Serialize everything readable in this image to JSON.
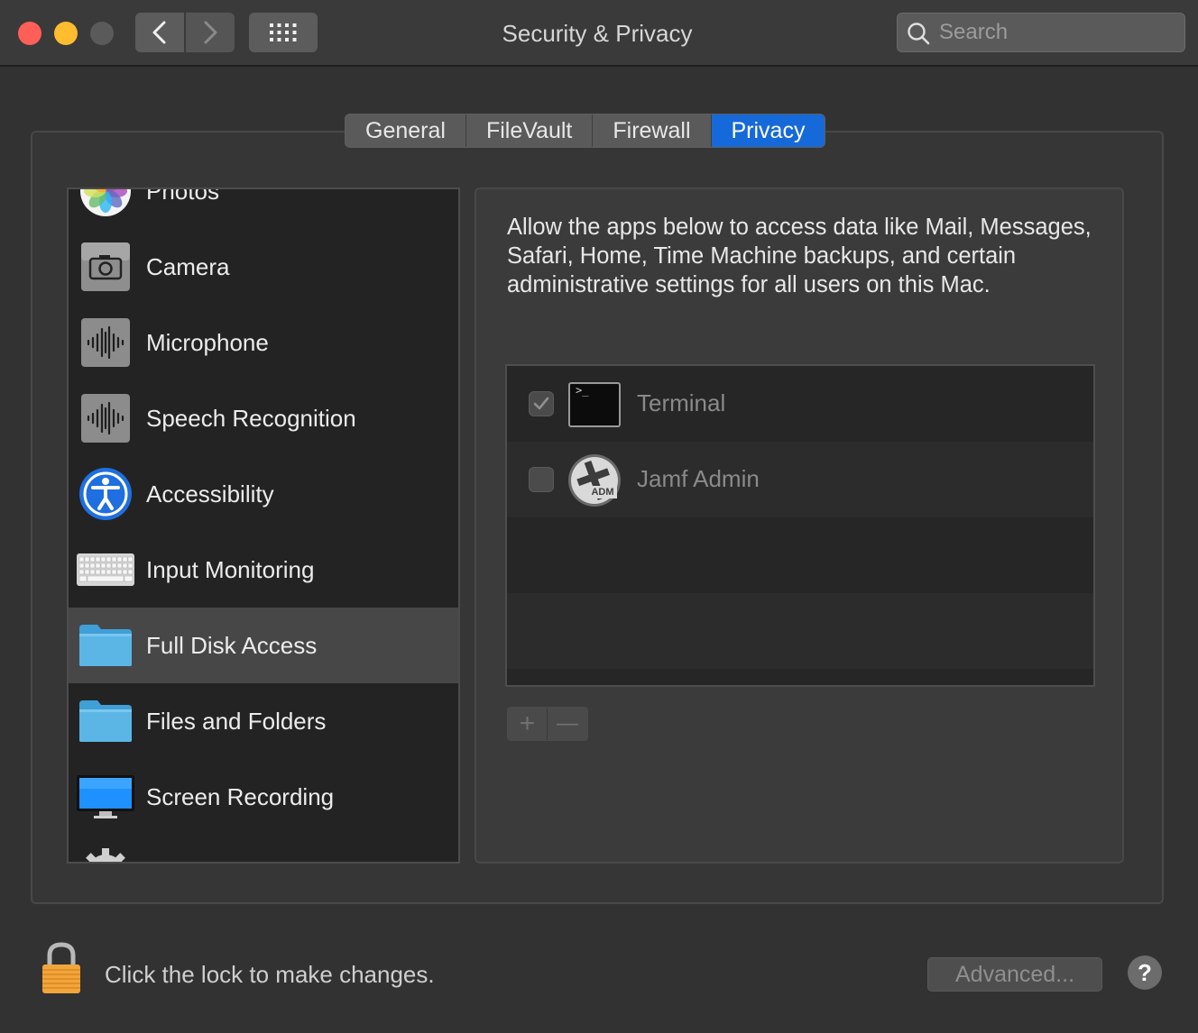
{
  "window": {
    "title": "Security & Privacy"
  },
  "toolbar": {
    "back_icon": "chevron-left-icon",
    "forward_icon": "chevron-right-icon",
    "grid_icon": "show-all-grid-icon"
  },
  "search": {
    "placeholder": "Search",
    "value": ""
  },
  "tabs": [
    {
      "label": "General",
      "active": false
    },
    {
      "label": "FileVault",
      "active": false
    },
    {
      "label": "Firewall",
      "active": false
    },
    {
      "label": "Privacy",
      "active": true
    }
  ],
  "sidebar": {
    "items": [
      {
        "label": "Photos",
        "icon": "photos-icon"
      },
      {
        "label": "Camera",
        "icon": "camera-icon"
      },
      {
        "label": "Microphone",
        "icon": "microphone-icon"
      },
      {
        "label": "Speech Recognition",
        "icon": "speech-recognition-icon"
      },
      {
        "label": "Accessibility",
        "icon": "accessibility-icon"
      },
      {
        "label": "Input Monitoring",
        "icon": "keyboard-icon"
      },
      {
        "label": "Full Disk Access",
        "icon": "folder-icon",
        "selected": true
      },
      {
        "label": "Files and Folders",
        "icon": "folder-icon"
      },
      {
        "label": "Screen Recording",
        "icon": "display-icon"
      },
      {
        "label": "",
        "icon": "gear-icon"
      }
    ]
  },
  "panel": {
    "description": "Allow the apps below to access data like Mail, Messages, Safari, Home, Time Machine backups, and certain administrative settings for all users on this Mac.",
    "apps": [
      {
        "label": "Terminal",
        "checked": true,
        "icon": "terminal-icon",
        "terminal_prompt": ">_"
      },
      {
        "label": "Jamf Admin",
        "checked": false,
        "icon": "jamf-admin-icon",
        "badge": "ADM"
      }
    ],
    "add_label": "+",
    "remove_label": "—"
  },
  "footer": {
    "lock_text": "Click the lock to make changes.",
    "advanced_label": "Advanced...",
    "help_label": "?"
  },
  "colors": {
    "accent": "#1669d9",
    "selected_row": "#474747",
    "close": "#ff5f57",
    "minimize": "#febc2e",
    "lock_gold": "#f2a53a"
  }
}
